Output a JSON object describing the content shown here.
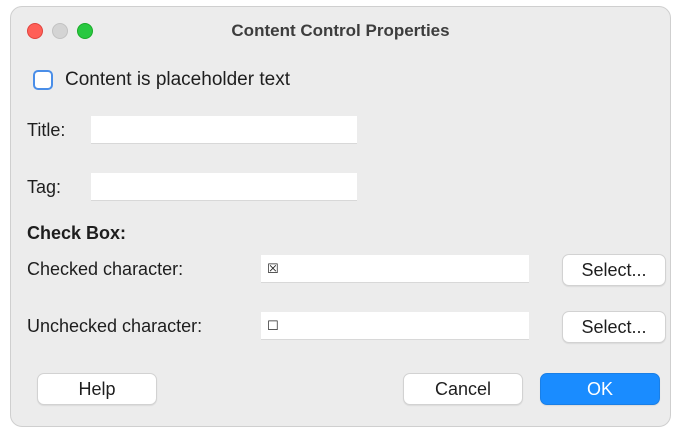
{
  "window": {
    "title": "Content Control Properties"
  },
  "placeholder_checkbox": {
    "label": "Content is placeholder text",
    "checked": false
  },
  "fields": {
    "title_label": "Title:",
    "title_value": "",
    "tag_label": "Tag:",
    "tag_value": ""
  },
  "check_box_section": {
    "heading": "Check Box:",
    "checked_label": "Checked character:",
    "checked_value": "☒",
    "unchecked_label": "Unchecked character:",
    "unchecked_value": "☐",
    "select_label": "Select..."
  },
  "buttons": {
    "help": "Help",
    "cancel": "Cancel",
    "ok": "OK"
  },
  "colors": {
    "accent": "#1a8cff",
    "close": "#ff5f57",
    "zoom": "#28c840",
    "checkbox_border": "#4a8ee8"
  }
}
